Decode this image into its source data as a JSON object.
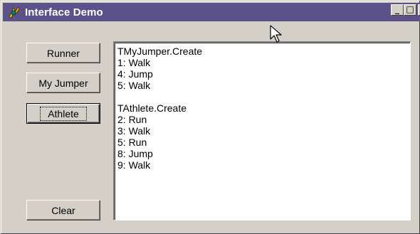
{
  "window": {
    "title": "Interface Demo",
    "controls": {
      "minimize": "_",
      "maximize": "□",
      "close": "×"
    },
    "icon": "app-icon"
  },
  "buttons": {
    "runner": "Runner",
    "my_jumper": "My Jumper",
    "athlete": "Athlete",
    "clear": "Clear"
  },
  "memo": {
    "lines": [
      "TMyJumper.Create",
      "1: Walk",
      "4: Jump",
      "5: Walk",
      "",
      "TAthlete.Create",
      "2: Run",
      "3: Walk",
      "5: Run",
      "8: Jump",
      "9: Walk"
    ]
  },
  "colors": {
    "titlebar": "#5b5289",
    "face": "#d4d0c8"
  }
}
